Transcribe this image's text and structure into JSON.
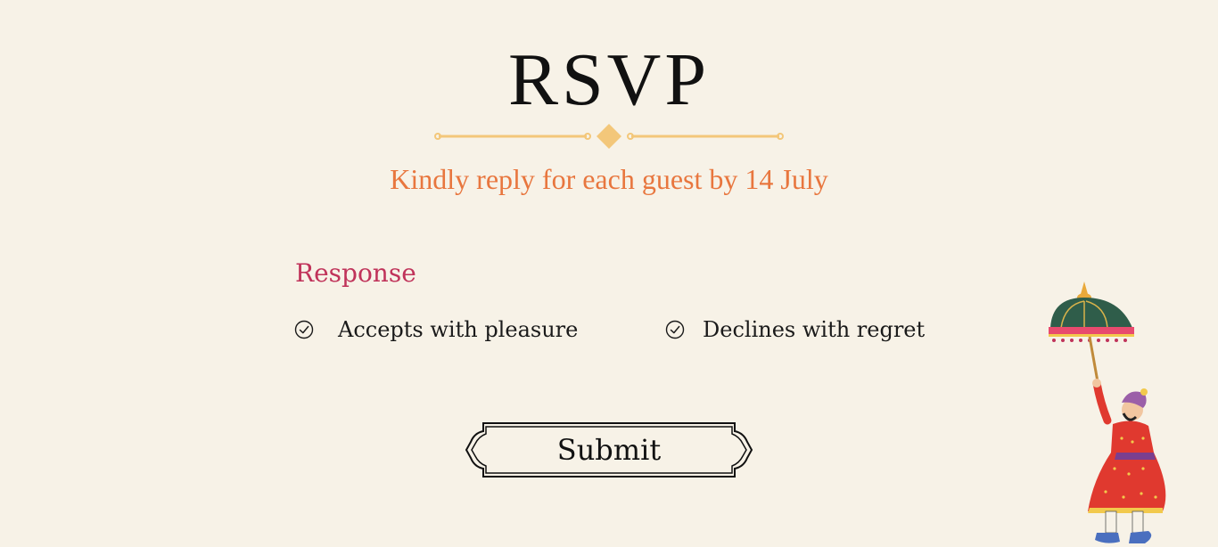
{
  "header": {
    "title": "RSVP",
    "subtitle": "Kindly reply for each guest by 14 July"
  },
  "form": {
    "response_label": "Response",
    "options": [
      {
        "label": "Accepts with pleasure",
        "icon": "check-circle-icon"
      },
      {
        "label": "Declines with regret",
        "icon": "check-circle-icon"
      }
    ],
    "submit_label": "Submit"
  },
  "colors": {
    "background": "#f7f2e7",
    "subtitle": "#e8763e",
    "response_label": "#c0335a",
    "divider": "#f3c77a",
    "text": "#111111"
  },
  "decoration": {
    "divider_icon": "ornamental-divider",
    "illustration_icon": "royal-umbrella-bearer-illustration"
  }
}
